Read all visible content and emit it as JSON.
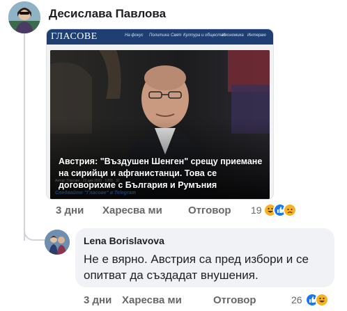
{
  "comment1": {
    "author": "Десислава Павлова",
    "shared_post": {
      "site_name": "ГЛАСОВЕ",
      "nav_items": [
        "На фокус",
        "Политика",
        "Свят",
        "Култура и общество",
        "Икономика",
        "Интервю"
      ],
      "headline": "Австрия: \"Въздушен Шенген\" срещу приемане на сирийци и афганистанци. Това се договорихме с България и Румъния",
      "meta": "Автор: Гласове · 22 дек 2023 · 1393 · 32",
      "follow_text": "Следвайте \"Гласове\" в Telegram"
    },
    "actions": {
      "time": "3 дни",
      "like": "Харесва ми",
      "reply": "Отговор"
    },
    "reaction_count": "19",
    "reaction_icons": [
      "haha-icon",
      "like-icon",
      "sad-icon"
    ]
  },
  "comment2": {
    "author": "Lena Borislavova",
    "text": "Не е вярно. Австрия са пред избори и се опитват да създадат внушения.",
    "actions": {
      "time": "3 дни",
      "like": "Харесва ми",
      "reply": "Отговор"
    },
    "reaction_count": "26",
    "reaction_icons": [
      "like-icon",
      "haha-icon"
    ]
  },
  "colors": {
    "site_nav_bg": "#1f3f73",
    "like_blue": "#1877f2",
    "reaction_yellow": "#f7b125",
    "bubble_bg": "#f0f2f5",
    "secondary_text": "#65676b"
  }
}
